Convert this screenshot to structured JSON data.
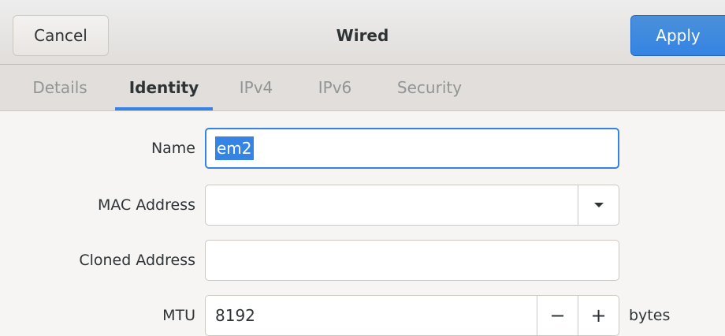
{
  "headerbar": {
    "cancel_label": "Cancel",
    "title": "Wired",
    "apply_label": "Apply"
  },
  "tabs": [
    {
      "label": "Details",
      "active": false
    },
    {
      "label": "Identity",
      "active": true
    },
    {
      "label": "IPv4",
      "active": false
    },
    {
      "label": "IPv6",
      "active": false
    },
    {
      "label": "Security",
      "active": false
    }
  ],
  "form": {
    "name_label": "Name",
    "name_value": "em2",
    "mac_label": "MAC Address",
    "mac_value": "",
    "cloned_label": "Cloned Address",
    "cloned_value": "",
    "mtu_label": "MTU",
    "mtu_value": "8192",
    "mtu_decrement": "−",
    "mtu_increment": "+",
    "mtu_units": "bytes"
  },
  "colors": {
    "accent": "#3584e4",
    "background": "#f6f5f4",
    "header": "#e1dedb"
  },
  "icons": {
    "mac_dropdown": "pan-down-icon"
  }
}
